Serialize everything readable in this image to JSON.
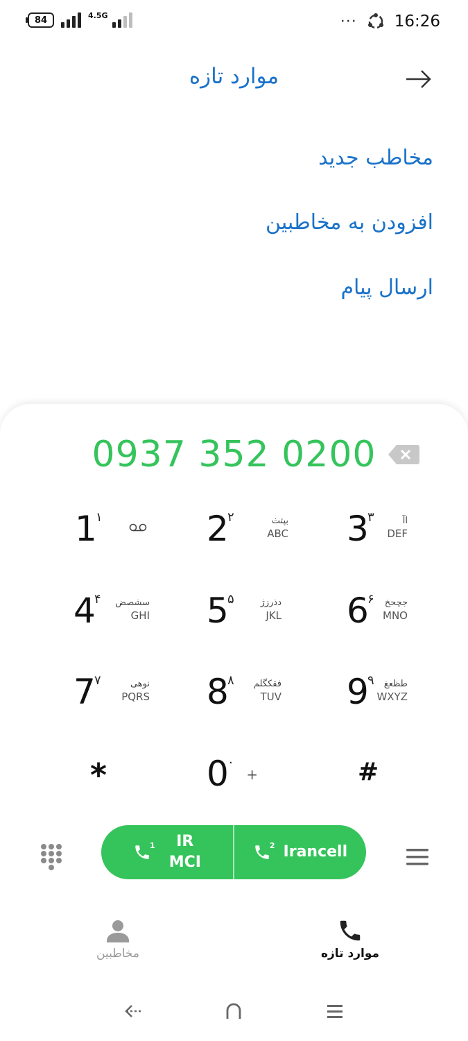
{
  "status_bar": {
    "battery": "84",
    "network": "4.5G",
    "overflow": "···",
    "time": "16:26"
  },
  "header": {
    "title": "موارد تازه"
  },
  "actions": [
    {
      "label": "مخاطب جدید"
    },
    {
      "label": "افزودن به مخاطبین"
    },
    {
      "label": "ارسال پیام"
    }
  ],
  "dialer": {
    "number": "0937 352 0200",
    "keys": [
      {
        "digit": "1",
        "fa": "۱",
        "sub1": "",
        "sub2": ""
      },
      {
        "digit": "2",
        "fa": "۲",
        "sub1": "بپتث",
        "sub2": "ABC"
      },
      {
        "digit": "3",
        "fa": "۳",
        "sub1": "اآ",
        "sub2": "DEF"
      },
      {
        "digit": "4",
        "fa": "۴",
        "sub1": "سشصض",
        "sub2": "GHI"
      },
      {
        "digit": "5",
        "fa": "۵",
        "sub1": "دذرزژ",
        "sub2": "JKL"
      },
      {
        "digit": "6",
        "fa": "۶",
        "sub1": "جچحخ",
        "sub2": "MNO"
      },
      {
        "digit": "7",
        "fa": "۷",
        "sub1": "نوهی",
        "sub2": "PQRS"
      },
      {
        "digit": "8",
        "fa": "۸",
        "sub1": "فقکگلم",
        "sub2": "TUV"
      },
      {
        "digit": "9",
        "fa": "۹",
        "sub1": "طظعغ",
        "sub2": "WXYZ"
      },
      {
        "digit": "*",
        "fa": "",
        "sub1": "",
        "sub2": ""
      },
      {
        "digit": "0",
        "fa": "۰",
        "sub1": "",
        "sub2": "+"
      },
      {
        "digit": "#",
        "fa": "",
        "sub1": "",
        "sub2": ""
      }
    ]
  },
  "call": {
    "sim1_label": "IR\nMCI",
    "sim1_line1": "IR",
    "sim1_line2": "MCI",
    "sim1_index": "1",
    "sim2_label": "Irancell",
    "sim2_index": "2"
  },
  "tabs": {
    "contacts": "مخاطبین",
    "recents": "موارد تازه"
  },
  "colors": {
    "accent": "#1a72c9",
    "green": "#35c45b"
  }
}
